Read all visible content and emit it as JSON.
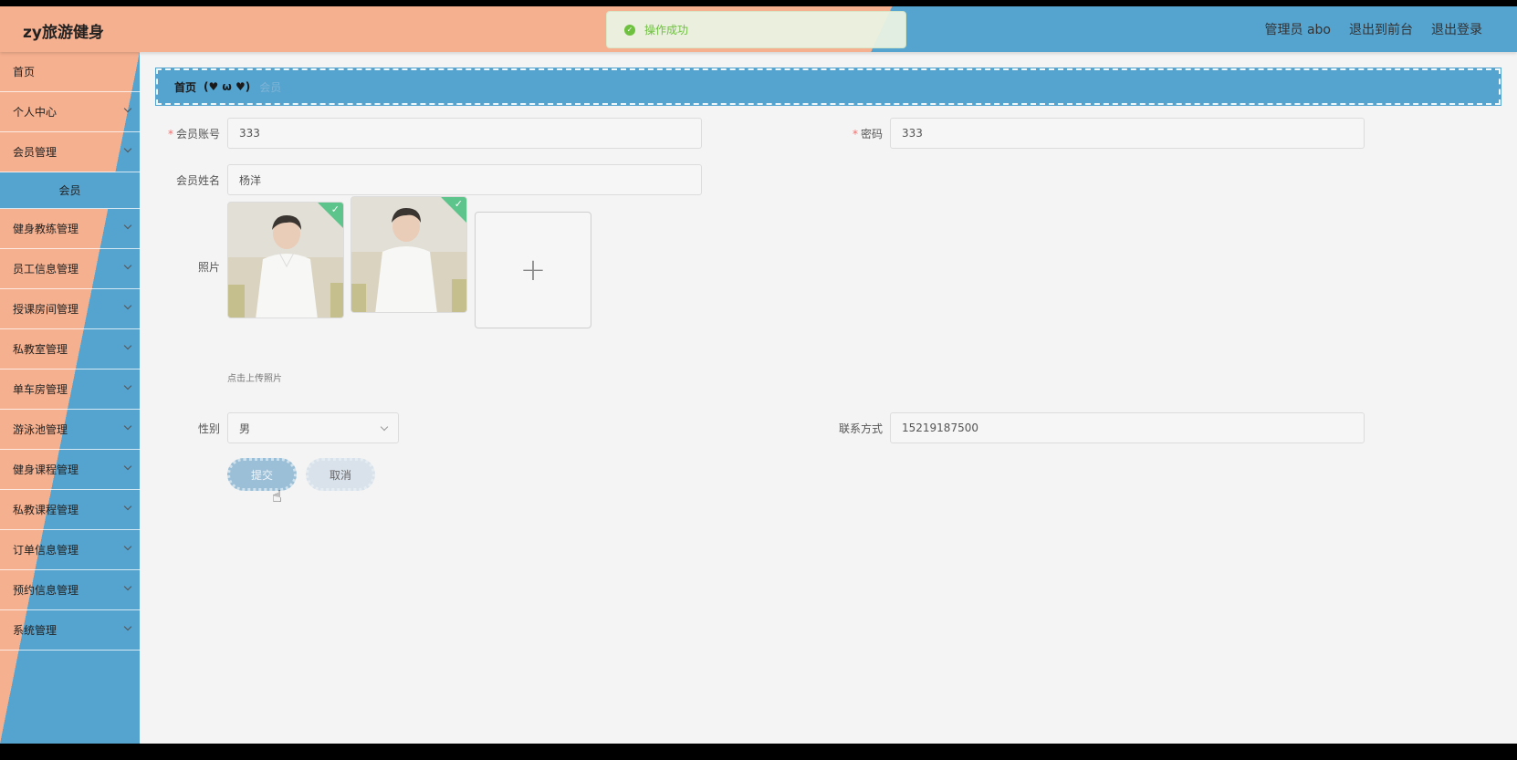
{
  "header": {
    "brand": "zy旅游健身",
    "admin_label": "管理员 abo",
    "to_front_label": "退出到前台",
    "logout_label": "退出登录"
  },
  "toast": {
    "message": "操作成功"
  },
  "sidebar": {
    "items": [
      {
        "label": "首页",
        "has_chevron": false
      },
      {
        "label": "个人中心",
        "has_chevron": true
      },
      {
        "label": "会员管理",
        "has_chevron": true
      },
      {
        "label": "会员",
        "has_chevron": false,
        "is_sub": true
      },
      {
        "label": "健身教练管理",
        "has_chevron": true
      },
      {
        "label": "员工信息管理",
        "has_chevron": true
      },
      {
        "label": "授课房间管理",
        "has_chevron": true
      },
      {
        "label": "私教室管理",
        "has_chevron": true
      },
      {
        "label": "单车房管理",
        "has_chevron": true
      },
      {
        "label": "游泳池管理",
        "has_chevron": true
      },
      {
        "label": "健身课程管理",
        "has_chevron": true
      },
      {
        "label": "私教课程管理",
        "has_chevron": true
      },
      {
        "label": "订单信息管理",
        "has_chevron": true
      },
      {
        "label": "预约信息管理",
        "has_chevron": true
      },
      {
        "label": "系统管理",
        "has_chevron": true
      }
    ]
  },
  "breadcrumb": {
    "home": "首页",
    "emoji": "(♥ ω ♥)",
    "current": "会员"
  },
  "form": {
    "account_label": "会员账号",
    "account_value": "333",
    "password_label": "密码",
    "password_value": "333",
    "name_label": "会员姓名",
    "name_value": "杨洋",
    "photo_label": "照片",
    "upload_hint": "点击上传照片",
    "upload_plus": "+",
    "gender_label": "性别",
    "gender_value": "男",
    "contact_label": "联系方式",
    "contact_value": "15219187500",
    "required_mark": "*"
  },
  "buttons": {
    "submit_label": "提交",
    "cancel_label": "取消"
  },
  "colors": {
    "orange": "#f5b08f",
    "blue": "#55a3cf",
    "success": "#67c23a"
  }
}
